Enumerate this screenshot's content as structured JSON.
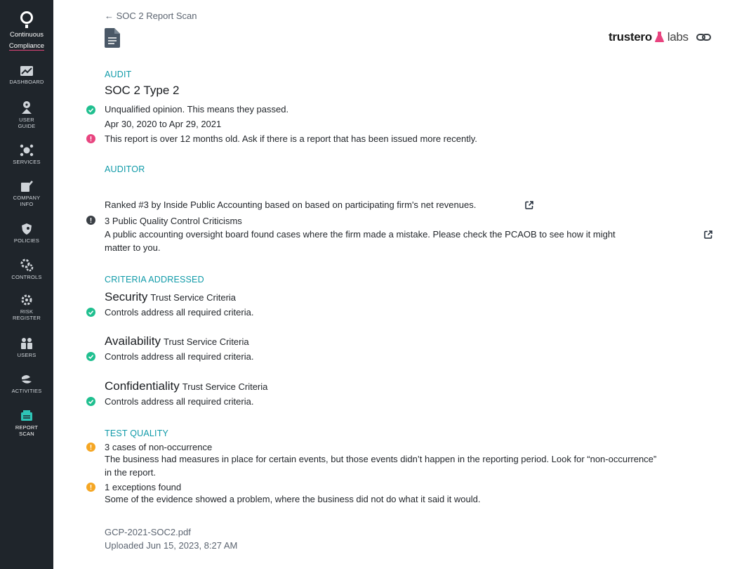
{
  "sidebar": {
    "logo": {
      "line1": "Continuous",
      "line2": "Compliance"
    },
    "items": [
      {
        "label1": "DASHBOARD",
        "label2": ""
      },
      {
        "label1": "USER",
        "label2": "GUIDE"
      },
      {
        "label1": "SERVICES",
        "label2": ""
      },
      {
        "label1": "COMPANY",
        "label2": "INFO"
      },
      {
        "label1": "POLICIES",
        "label2": ""
      },
      {
        "label1": "CONTROLS",
        "label2": ""
      },
      {
        "label1": "RISK",
        "label2": "REGISTER"
      },
      {
        "label1": "USERS",
        "label2": ""
      },
      {
        "label1": "ACTIVITIES",
        "label2": ""
      },
      {
        "label1": "REPORT",
        "label2": "SCAN"
      }
    ]
  },
  "header": {
    "back_label": "SOC 2 Report Scan",
    "brand_name": "trustero",
    "brand_suffix": "labs"
  },
  "audit": {
    "heading": "AUDIT",
    "title": "SOC 2 Type 2",
    "opinion": "Unqualified opinion. This means they passed.",
    "period": "Apr 30, 2020 to Apr 29, 2021",
    "age_warning": "This report is over 12 months old. Ask if there is a report that has been issued more recently."
  },
  "auditor": {
    "heading": "AUDITOR",
    "ranking": "Ranked #3 by Inside Public Accounting based on based on participating firm's net revenues.",
    "criticisms_title": "3 Public Quality Control Criticisms",
    "criticisms_line1": "A public accounting oversight board found cases where the firm made a mistake. Please check the PCAOB to see how it might",
    "criticisms_line2": "matter to you."
  },
  "criteria": {
    "heading": "CRITERIA ADDRESSED",
    "items": [
      {
        "name": "Security",
        "type": "Trust Service Criteria",
        "status": "Controls address all required criteria."
      },
      {
        "name": "Availability",
        "type": "Trust Service Criteria",
        "status": "Controls address all required criteria."
      },
      {
        "name": "Confidentiality",
        "type": "Trust Service Criteria",
        "status": "Controls address all required criteria."
      }
    ]
  },
  "test_quality": {
    "heading": "TEST QUALITY",
    "nonoccurrence_title": "3 cases of non-occurrence",
    "nonoccurrence_line1": "The business had measures in place for certain events, but those events didn’t happen in the reporting period. Look for “non-occurrence”",
    "nonoccurrence_line2": "in the report.",
    "exceptions_title": "1 exceptions found",
    "exceptions_desc": "Some of the evidence showed a problem, where the business did not do what it said it would."
  },
  "file": {
    "name": "GCP-2021-SOC2.pdf",
    "uploaded": "Uploaded Jun 15, 2023, 8:27 AM"
  },
  "colors": {
    "sidebar_bg": "#1f252b",
    "accent_teal": "#0f9aa8",
    "success": "#1fbf8f",
    "alert_pink": "#e8447f",
    "warning": "#f5a623",
    "neutral_dark": "#3a3f45"
  }
}
